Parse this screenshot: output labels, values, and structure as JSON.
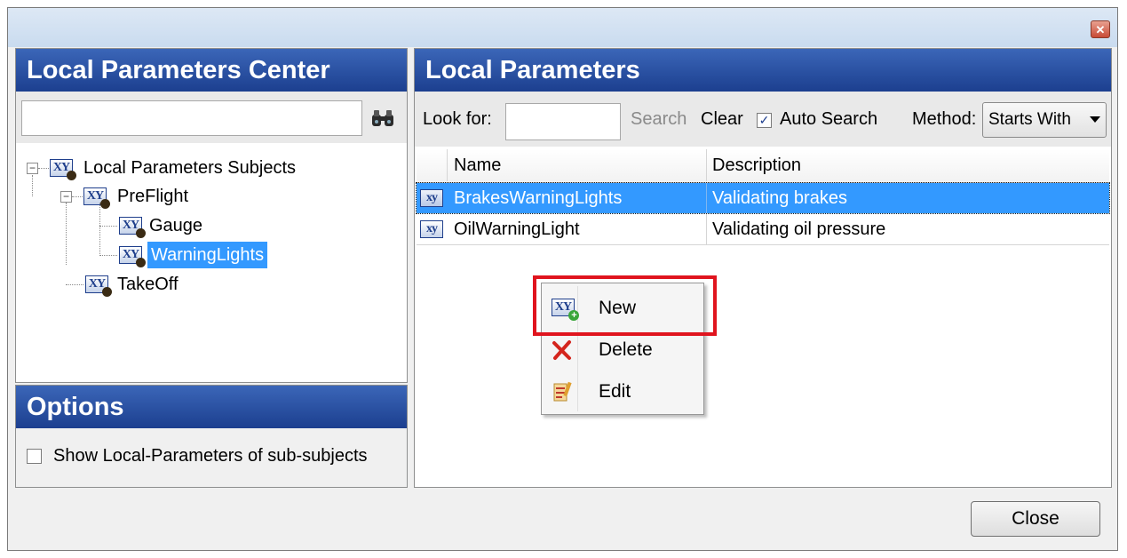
{
  "window": {
    "close_glyph": "✕"
  },
  "left_panel": {
    "title": "Local Parameters Center",
    "search_value": "",
    "search_icon": "binoculars-icon",
    "tree": {
      "root": "Local Parameters Subjects",
      "preflight": "PreFlight",
      "gauge": "Gauge",
      "warninglights": "WarningLights",
      "takeoff": "TakeOff"
    }
  },
  "options": {
    "title": "Options",
    "show_sub_label": "Show Local-Parameters of sub-subjects",
    "show_sub_checked": false
  },
  "right_panel": {
    "title": "Local Parameters",
    "look_for_label": "Look for:",
    "look_for_value": "",
    "search_label": "Search",
    "clear_label": "Clear",
    "auto_search_label": "Auto Search",
    "auto_search_checked": true,
    "method_label": "Method:",
    "method_value": "Starts With",
    "columns": [
      "Name",
      "Description"
    ],
    "rows": [
      {
        "icon": "xy",
        "name": "BrakesWarningLights",
        "description": "Validating brakes",
        "selected": true
      },
      {
        "icon": "xy",
        "name": "OilWarningLight",
        "description": "Validating oil pressure",
        "selected": false
      }
    ]
  },
  "context_menu": {
    "items": [
      {
        "label": "New",
        "icon": "new-parameter-icon"
      },
      {
        "label": "Delete",
        "icon": "delete-icon"
      },
      {
        "label": "Edit",
        "icon": "edit-icon"
      }
    ]
  },
  "footer": {
    "close_label": "Close"
  },
  "colors": {
    "header_blue": "#2a4fa3",
    "selection_blue": "#3399ff",
    "highlight_red": "#e0141e"
  }
}
